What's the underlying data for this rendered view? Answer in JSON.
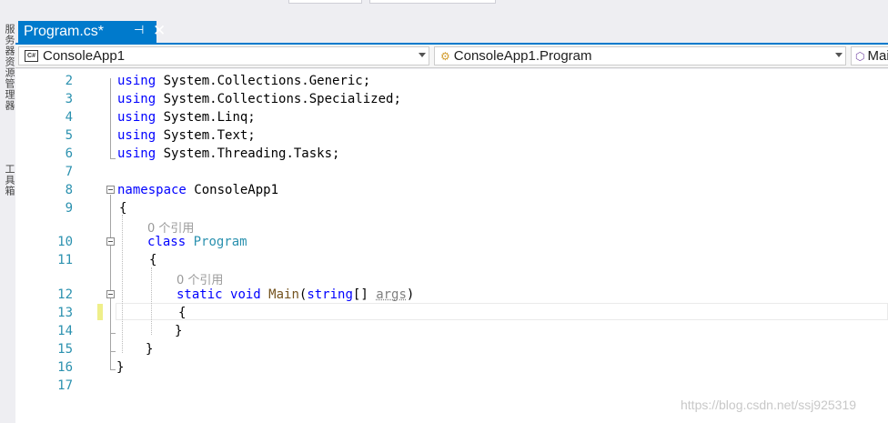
{
  "side_panel": {
    "server_explorer": "服务器资源管理器",
    "toolbox": "工具箱"
  },
  "tab": {
    "title": "Program.cs*",
    "pin_icon": "pin-icon",
    "close_icon": "close-icon"
  },
  "navbar": {
    "project": "ConsoleApp1",
    "type": "ConsoleApp1.Program",
    "member": "Main"
  },
  "code": {
    "line_numbers": [
      "2",
      "3",
      "4",
      "5",
      "6",
      "7",
      "8",
      "9",
      "10",
      "11",
      "12",
      "13",
      "14",
      "15",
      "16",
      "17"
    ],
    "usings": [
      "System.Collections.Generic;",
      "System.Collections.Specialized;",
      "System.Linq;",
      "System.Text;",
      "System.Threading.Tasks;"
    ],
    "using_kw": "using",
    "namespace_kw": "namespace",
    "namespace_name": "ConsoleApp1",
    "open_brace": "{",
    "close_brace": "}",
    "ref_hint": "0 个引用",
    "class_kw": "class",
    "class_name": "Program",
    "static_kw": "static",
    "void_kw": "void",
    "method_name": "Main",
    "open_paren": "(",
    "string_kw": "string",
    "brackets_space": "[] ",
    "param": "args",
    "close_paren": ")"
  },
  "watermark": "https://blog.csdn.net/ssj925319",
  "colors": {
    "accent": "#007acc",
    "keyword": "#0000ff",
    "type": "#2b91af",
    "line_number": "#2b91af"
  }
}
